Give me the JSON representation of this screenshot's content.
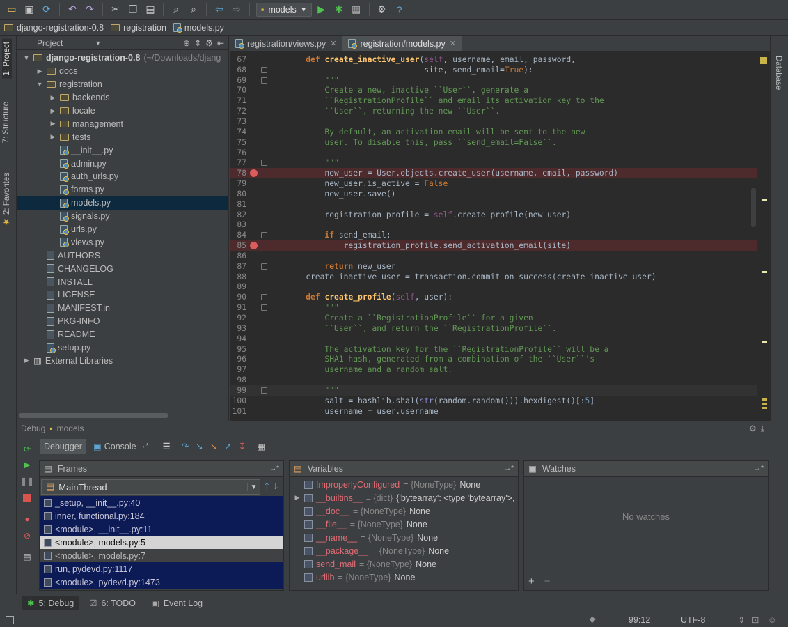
{
  "toolbar": {
    "run_config": "models"
  },
  "breadcrumb": [
    "django-registration-0.8",
    "registration",
    "models.py"
  ],
  "left_tabs": {
    "project": "1: Project",
    "structure": "7: Structure",
    "favorites": "2: Favorites"
  },
  "right_tabs": {
    "database": "Database"
  },
  "project_panel": {
    "title": "Project"
  },
  "tree": [
    {
      "name": "django-registration-0.8",
      "suffix": "(~/Downloads/djang",
      "type": "folder",
      "level": 0,
      "arrow": "open",
      "bold": true
    },
    {
      "name": "docs",
      "type": "folder",
      "level": 1,
      "arrow": "closed"
    },
    {
      "name": "registration",
      "type": "folder",
      "level": 1,
      "arrow": "open"
    },
    {
      "name": "backends",
      "type": "folder",
      "level": 2,
      "arrow": "closed"
    },
    {
      "name": "locale",
      "type": "folder",
      "level": 2,
      "arrow": "closed"
    },
    {
      "name": "management",
      "type": "folder",
      "level": 2,
      "arrow": "closed"
    },
    {
      "name": "tests",
      "type": "folder",
      "level": 2,
      "arrow": "closed"
    },
    {
      "name": "__init__.py",
      "type": "py",
      "level": 2
    },
    {
      "name": "admin.py",
      "type": "py",
      "level": 2
    },
    {
      "name": "auth_urls.py",
      "type": "py",
      "level": 2
    },
    {
      "name": "forms.py",
      "type": "py",
      "level": 2
    },
    {
      "name": "models.py",
      "type": "py",
      "level": 2,
      "selected": true
    },
    {
      "name": "signals.py",
      "type": "py",
      "level": 2
    },
    {
      "name": "urls.py",
      "type": "py",
      "level": 2
    },
    {
      "name": "views.py",
      "type": "py",
      "level": 2
    },
    {
      "name": "AUTHORS",
      "type": "file",
      "level": 1
    },
    {
      "name": "CHANGELOG",
      "type": "file",
      "level": 1
    },
    {
      "name": "INSTALL",
      "type": "file",
      "level": 1
    },
    {
      "name": "LICENSE",
      "type": "file",
      "level": 1
    },
    {
      "name": "MANIFEST.in",
      "type": "file",
      "level": 1
    },
    {
      "name": "PKG-INFO",
      "type": "file",
      "level": 1
    },
    {
      "name": "README",
      "type": "file",
      "level": 1
    },
    {
      "name": "setup.py",
      "type": "py",
      "level": 1
    },
    {
      "name": "External Libraries",
      "type": "lib",
      "level": 0,
      "arrow": "closed"
    }
  ],
  "editor_tabs": [
    {
      "label": "registration/views.py",
      "active": false
    },
    {
      "label": "registration/models.py",
      "active": true
    }
  ],
  "code_lines": [
    {
      "n": 67,
      "fold": false,
      "bp": false,
      "s": [
        [
          "    ",
          "tx"
        ],
        [
          "def ",
          "kw"
        ],
        [
          "create_inactive_user",
          "fn"
        ],
        [
          "(",
          "tx"
        ],
        [
          "self",
          "sf"
        ],
        [
          ", username, email, password,",
          "tx"
        ]
      ]
    },
    {
      "n": 68,
      "fold": true,
      "bp": false,
      "s": [
        [
          "                             site, send_email=",
          "tx"
        ],
        [
          "True",
          "cst"
        ],
        [
          "):",
          "tx"
        ]
      ]
    },
    {
      "n": 69,
      "fold": true,
      "bp": false,
      "s": [
        [
          "        \"\"\"",
          "st"
        ]
      ]
    },
    {
      "n": 70,
      "fold": false,
      "bp": false,
      "s": [
        [
          "        Create a new, inactive ``User``, generate a",
          "st"
        ]
      ]
    },
    {
      "n": 71,
      "fold": false,
      "bp": false,
      "s": [
        [
          "        ``RegistrationProfile`` and email its activation key to the",
          "st"
        ]
      ]
    },
    {
      "n": 72,
      "fold": false,
      "bp": false,
      "s": [
        [
          "        ``User``, returning the new ``User``.",
          "st"
        ]
      ]
    },
    {
      "n": 73,
      "fold": false,
      "bp": false,
      "s": [
        [
          "",
          "tx"
        ]
      ]
    },
    {
      "n": 74,
      "fold": false,
      "bp": false,
      "s": [
        [
          "        By default, an activation email will be sent to the new",
          "st"
        ]
      ]
    },
    {
      "n": 75,
      "fold": false,
      "bp": false,
      "s": [
        [
          "        user. To disable this, pass ``send_email=False``.",
          "st"
        ]
      ]
    },
    {
      "n": 76,
      "fold": false,
      "bp": false,
      "s": [
        [
          "",
          "tx"
        ]
      ]
    },
    {
      "n": 77,
      "fold": true,
      "bp": false,
      "s": [
        [
          "        \"\"\"",
          "st"
        ]
      ]
    },
    {
      "n": 78,
      "fold": false,
      "bp": true,
      "s": [
        [
          "        new_user = User.objects.create_user(username, email, password)",
          "tx"
        ]
      ]
    },
    {
      "n": 79,
      "fold": false,
      "bp": false,
      "s": [
        [
          "        new_user.is_active = ",
          "tx"
        ],
        [
          "False",
          "cst"
        ]
      ]
    },
    {
      "n": 80,
      "fold": false,
      "bp": false,
      "s": [
        [
          "        new_user.save()",
          "tx"
        ]
      ]
    },
    {
      "n": 81,
      "fold": false,
      "bp": false,
      "s": [
        [
          "",
          "tx"
        ]
      ]
    },
    {
      "n": 82,
      "fold": false,
      "bp": false,
      "s": [
        [
          "        registration_profile = ",
          "tx"
        ],
        [
          "self",
          "sf"
        ],
        [
          ".create_profile(new_user)",
          "tx"
        ]
      ]
    },
    {
      "n": 83,
      "fold": false,
      "bp": false,
      "s": [
        [
          "",
          "tx"
        ]
      ]
    },
    {
      "n": 84,
      "fold": true,
      "bp": false,
      "s": [
        [
          "        ",
          "tx"
        ],
        [
          "if ",
          "kw"
        ],
        [
          "send_email:",
          "tx"
        ]
      ]
    },
    {
      "n": 85,
      "fold": false,
      "bp": true,
      "s": [
        [
          "            registration_profile.send_activation_email(site)",
          "tx"
        ]
      ]
    },
    {
      "n": 86,
      "fold": false,
      "bp": false,
      "s": [
        [
          "",
          "tx"
        ]
      ]
    },
    {
      "n": 87,
      "fold": true,
      "bp": false,
      "s": [
        [
          "        ",
          "tx"
        ],
        [
          "return ",
          "kw"
        ],
        [
          "new_user",
          "tx"
        ]
      ]
    },
    {
      "n": 88,
      "fold": false,
      "bp": false,
      "s": [
        [
          "    create_inactive_user = transaction.commit_on_success(create_inactive_user)",
          "tx"
        ]
      ]
    },
    {
      "n": 89,
      "fold": false,
      "bp": false,
      "s": [
        [
          "",
          "tx"
        ]
      ]
    },
    {
      "n": 90,
      "fold": true,
      "bp": false,
      "s": [
        [
          "    ",
          "tx"
        ],
        [
          "def ",
          "kw"
        ],
        [
          "create_profile",
          "fn"
        ],
        [
          "(",
          "tx"
        ],
        [
          "self",
          "sf"
        ],
        [
          ", user):",
          "tx"
        ]
      ]
    },
    {
      "n": 91,
      "fold": true,
      "bp": false,
      "s": [
        [
          "        \"\"\"",
          "st"
        ]
      ]
    },
    {
      "n": 92,
      "fold": false,
      "bp": false,
      "s": [
        [
          "        Create a ``RegistrationProfile`` for a given",
          "st"
        ]
      ]
    },
    {
      "n": 93,
      "fold": false,
      "bp": false,
      "s": [
        [
          "        ``User``, and return the ``RegistrationProfile``.",
          "st"
        ]
      ]
    },
    {
      "n": 94,
      "fold": false,
      "bp": false,
      "s": [
        [
          "",
          "tx"
        ]
      ]
    },
    {
      "n": 95,
      "fold": false,
      "bp": false,
      "s": [
        [
          "        The activation key for the ``RegistrationProfile`` will be a",
          "st"
        ]
      ]
    },
    {
      "n": 96,
      "fold": false,
      "bp": false,
      "s": [
        [
          "        SHA1 hash, generated from a combination of the ``User``'s",
          "st"
        ]
      ]
    },
    {
      "n": 97,
      "fold": false,
      "bp": false,
      "s": [
        [
          "        username and a random salt.",
          "st"
        ]
      ]
    },
    {
      "n": 98,
      "fold": false,
      "bp": false,
      "s": [
        [
          "",
          "tx"
        ]
      ]
    },
    {
      "n": 99,
      "fold": true,
      "bp": false,
      "cur": true,
      "s": [
        [
          "        \"\"\"",
          "st"
        ]
      ]
    },
    {
      "n": 100,
      "fold": false,
      "bp": false,
      "s": [
        [
          "        salt = hashlib.sha1(",
          "tx"
        ],
        [
          "str",
          "bi"
        ],
        [
          "(random.random())).hexdigest()[:",
          "tx"
        ],
        [
          "5",
          "nu"
        ],
        [
          "]",
          "tx"
        ]
      ]
    },
    {
      "n": 101,
      "fold": false,
      "bp": false,
      "s": [
        [
          "        username = user.username",
          "tx"
        ]
      ]
    }
  ],
  "debug": {
    "title": "Debug",
    "config": "models",
    "tabs": {
      "debugger": "Debugger",
      "console": "Console"
    },
    "frames_title": "Frames",
    "thread": "MainThread",
    "frames": [
      {
        "label": "_setup, __init__.py:40",
        "kind": "lib"
      },
      {
        "label": "inner, functional.py:184",
        "kind": "lib"
      },
      {
        "label": "<module>, __init__.py:11",
        "kind": "lib"
      },
      {
        "label": "<module>, models.py:5",
        "kind": "selected"
      },
      {
        "label": "<module>, models.py:7",
        "kind": "user"
      },
      {
        "label": "run, pydevd.py:1117",
        "kind": "lib"
      },
      {
        "label": "<module>, pydevd.py:1473",
        "kind": "lib"
      }
    ],
    "variables_title": "Variables",
    "variables": [
      {
        "name": "ImproperlyConfigured",
        "type": "= {NoneType}",
        "value": "None",
        "expand": false
      },
      {
        "name": "__builtins__",
        "type": "= {dict}",
        "value": "{'bytearray': <type 'bytearray'>,",
        "expand": true
      },
      {
        "name": "__doc__",
        "type": "= {NoneType}",
        "value": "None",
        "expand": false
      },
      {
        "name": "__file__",
        "type": "= {NoneType}",
        "value": "None",
        "expand": false
      },
      {
        "name": "__name__",
        "type": "= {NoneType}",
        "value": "None",
        "expand": false
      },
      {
        "name": "__package__",
        "type": "= {NoneType}",
        "value": "None",
        "expand": false
      },
      {
        "name": "send_mail",
        "type": "= {NoneType}",
        "value": "None",
        "expand": false
      },
      {
        "name": "urllib",
        "type": "= {NoneType}",
        "value": "None",
        "expand": false
      }
    ],
    "watches_title": "Watches",
    "no_watches": "No watches"
  },
  "bottom_tabs": [
    {
      "num": "5",
      "label": ": Debug",
      "active": true
    },
    {
      "num": "6",
      "label": ": TODO",
      "active": false
    },
    {
      "num": "",
      "label": "Event Log",
      "active": false
    }
  ],
  "status": {
    "position": "99:12",
    "encoding": "UTF-8"
  },
  "colors": {
    "breakpoint": "#db5c5c",
    "selection": "#0d293e",
    "frame_bg": "#0c1a55",
    "string": "#629755",
    "keyword": "#cc7832"
  }
}
